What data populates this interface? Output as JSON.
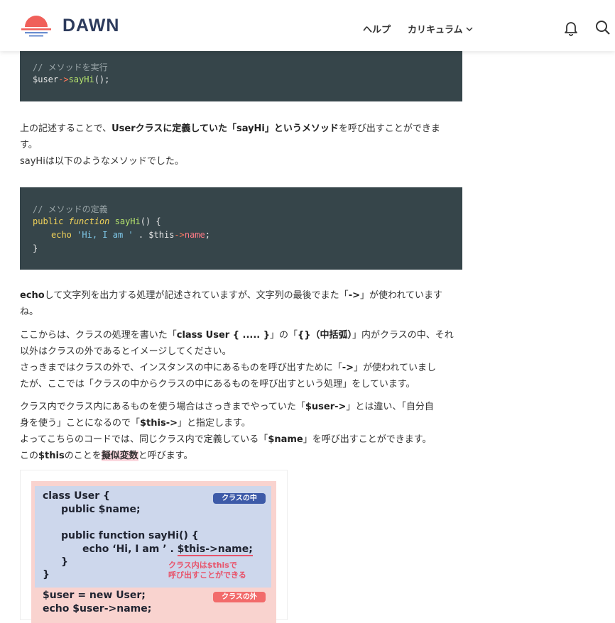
{
  "header": {
    "brand": "DAWN",
    "nav_help": "ヘルプ",
    "nav_curriculum": "カリキュラム",
    "icons": [
      "bell-icon",
      "search-icon",
      "chevron-down-icon"
    ]
  },
  "code1": {
    "comment": "// メソッドを実行",
    "var": "$user",
    "arrow": "->",
    "call": "sayHi",
    "tail": "();"
  },
  "para1": {
    "a": "上の記述することで、",
    "b": "Userクラスに定義していた「sayHi」というメソッド",
    "c": "を呼び出すことができま",
    "d": "す。",
    "e": "sayHiは以下のようなメソッドでした。"
  },
  "code2": {
    "comment": "// メソッドの定義",
    "public": "public",
    "function": "function",
    "fname": "sayHi",
    "open": "() {",
    "echo": "echo",
    "str": "'Hi, I am '",
    "dot": " . $this",
    "arrow": "->",
    "prop": "name",
    "semi": ";",
    "close": "}"
  },
  "para2": {
    "a": "echo",
    "b": "して文字列を出力する処理が記述されていますが、文字列の最後でまた「",
    "c": "->",
    "d": "」が使われていま",
    "e2": "す",
    "f": "ね。"
  },
  "para3": {
    "l1a": "ここからは、クラスの処理を書いた「",
    "l1b": "class User { ..... }",
    "l1c": "」の「",
    "l1d": "{}（中括弧）",
    "l1e": "」内がクラスの中、それ",
    "l2": "以外はクラスの外であるとイメージしてください。",
    "l3a": "さっきまではクラスの外で、インスタンスの中にあるものを呼び出すために「",
    "l3b": "->",
    "l3c": "」が使われていまし",
    "l4": "たが、ここでは「クラスの中からクラスの中にあるものを呼び出すという処理」をしています。"
  },
  "para4": {
    "l1a": "クラス内でクラス内にあるものを使う場合はさっきまでやっていた「",
    "l1b": "$user->",
    "l1c": "」とは違い、「自分自",
    "l2a": "身を使う」ことになるので「",
    "l2b": "$this->",
    "l2c": "」と指定します。",
    "l3a": "よってこちらのコードでは、同じクラス内で定義している「",
    "l3b": "$name",
    "l3c": "」を呼び出すことができます。",
    "l4a": "この",
    "l4b": "$this",
    "l4c": "のことを",
    "l4d": "擬似変数",
    "l4e": "と呼びます。"
  },
  "figure": {
    "line1": "class User {",
    "line2": "public $name;",
    "line3": "public function sayHi() {",
    "line4a": "echo ‘Hi, I am ’ . ",
    "line4b": "$this->name;",
    "line5": "}",
    "line6": "}",
    "line7": "$user = new User;",
    "line8": "echo $user->name;",
    "badge_in": "クラスの中",
    "badge_out": "クラスの外",
    "note1": "クラス内は$thisで",
    "note2": "呼び出すことができる",
    "colors": {
      "inner_bg": "#cdd7ec",
      "outer_bg": "#f9d3cf",
      "badge_in": "#3d5aa8",
      "badge_out": "#f26b6b",
      "note": "#e8536a"
    }
  }
}
